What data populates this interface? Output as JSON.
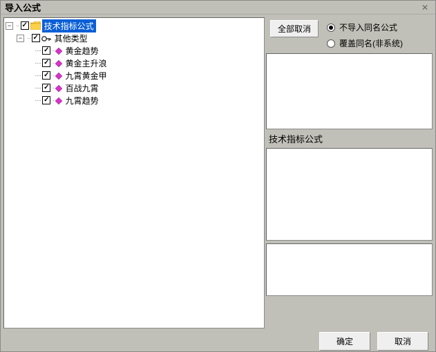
{
  "window": {
    "title": "导入公式"
  },
  "tree": {
    "root": {
      "label": "技术指标公式",
      "selected": true,
      "checked": true,
      "expanded": true,
      "child": {
        "label": "其他类型",
        "checked": true,
        "expanded": true,
        "items": [
          {
            "label": "黄金趋势",
            "checked": true
          },
          {
            "label": "黄金主升浪",
            "checked": true
          },
          {
            "label": "九霄黄金甲",
            "checked": true
          },
          {
            "label": "百战九霄",
            "checked": true
          },
          {
            "label": "九霄趋势",
            "checked": true
          }
        ]
      }
    }
  },
  "right": {
    "deselect_all": "全部取消",
    "radio_skip": "不导入同名公式",
    "radio_overwrite": "覆盖同名(非系统)",
    "radio_selected": "skip",
    "section_label": "技术指标公式"
  },
  "footer": {
    "ok": "确定",
    "cancel": "取消"
  },
  "glyphs": {
    "minus": "−",
    "close": "✕"
  }
}
